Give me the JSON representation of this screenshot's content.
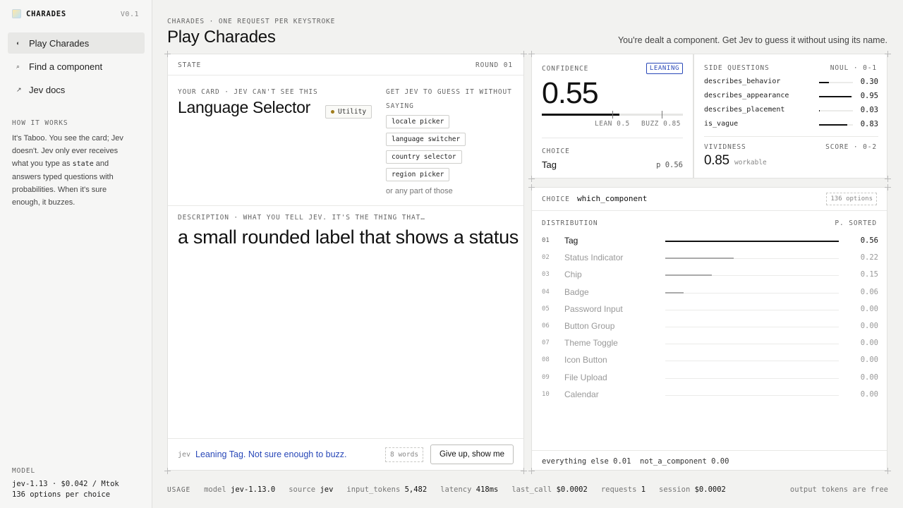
{
  "app": {
    "name": "CHARADES",
    "version": "V0.1"
  },
  "sidebar": {
    "nav": [
      {
        "label": "Play Charades",
        "icon": "◐",
        "icon_name": "half-circle-icon"
      },
      {
        "label": "Find a component",
        "icon": "⌕",
        "icon_name": "search-icon"
      },
      {
        "label": "Jev docs",
        "icon": "↗",
        "icon_name": "external-link-icon"
      }
    ],
    "how_it_works": {
      "title": "HOW IT WORKS",
      "text_1": "It's Taboo. You see the card; Jev doesn't. Jev only ever receives what you type as ",
      "code": "state",
      "text_2": " and answers typed questions with probabilities. When it's sure enough, it buzzes."
    },
    "model": {
      "title": "MODEL",
      "line_1": "jev-1.13 · $0.042 / Mtok",
      "line_2": "136 options per choice"
    }
  },
  "header": {
    "crumb": "CHARADES · ONE REQUEST PER KEYSTROKE",
    "title": "Play Charades",
    "subtitle": "You're dealt a component. Get Jev to guess it without using its name."
  },
  "state": {
    "label": "STATE",
    "round": "ROUND 01",
    "card_caption": "YOUR CARD · JEV CAN'T SEE THIS",
    "card_name": "Language Selector",
    "card_category": "Utility",
    "guess_caption": "GET JEV TO GUESS IT WITHOUT SAYING",
    "taboo_words": [
      "locale picker",
      "language switcher",
      "country selector",
      "region picker"
    ],
    "taboo_note": "or any part of those",
    "description_caption": "DESCRIPTION · WHAT YOU TELL JEV. IT'S THE THING THAT…",
    "description": "a small rounded label that shows a status",
    "footer": {
      "speaker": "jev",
      "message": "Leaning Tag. Not sure enough to buzz.",
      "word_count": "8 words",
      "give_up_label": "Give up, show me"
    }
  },
  "confidence": {
    "label": "CONFIDENCE",
    "badge": "LEANING",
    "value_text": "0.55",
    "value": 0.55,
    "lean_label": "LEAN 0.5",
    "lean_threshold": 0.5,
    "buzz_label": "BUZZ 0.85",
    "buzz_threshold": 0.85,
    "choice_label": "CHOICE",
    "choice_value": "Tag",
    "choice_p": "p 0.56"
  },
  "side_questions": {
    "label": "SIDE QUESTIONS",
    "meta": "NOUL · 0-1",
    "items": [
      {
        "name": "describes_behavior",
        "value": 0.3,
        "value_text": "0.30"
      },
      {
        "name": "describes_appearance",
        "value": 0.95,
        "value_text": "0.95"
      },
      {
        "name": "describes_placement",
        "value": 0.03,
        "value_text": "0.03"
      },
      {
        "name": "is_vague",
        "value": 0.83,
        "value_text": "0.83"
      }
    ],
    "vividness_label": "VIVIDNESS",
    "vividness_meta": "SCORE · 0-2",
    "vividness_value": "0.85",
    "vividness_note": "workable"
  },
  "distribution": {
    "choice_label": "CHOICE",
    "choice_name": "which_component",
    "options_badge": "136 options",
    "label": "DISTRIBUTION",
    "meta": "P. SORTED",
    "rows": [
      {
        "idx": "01",
        "label": "Tag",
        "p": 0.56,
        "p_text": "0.56"
      },
      {
        "idx": "02",
        "label": "Status Indicator",
        "p": 0.22,
        "p_text": "0.22"
      },
      {
        "idx": "03",
        "label": "Chip",
        "p": 0.15,
        "p_text": "0.15"
      },
      {
        "idx": "04",
        "label": "Badge",
        "p": 0.06,
        "p_text": "0.06"
      },
      {
        "idx": "05",
        "label": "Password Input",
        "p": 0.0,
        "p_text": "0.00"
      },
      {
        "idx": "06",
        "label": "Button Group",
        "p": 0.0,
        "p_text": "0.00"
      },
      {
        "idx": "07",
        "label": "Theme Toggle",
        "p": 0.0,
        "p_text": "0.00"
      },
      {
        "idx": "08",
        "label": "Icon Button",
        "p": 0.0,
        "p_text": "0.00"
      },
      {
        "idx": "09",
        "label": "File Upload",
        "p": 0.0,
        "p_text": "0.00"
      },
      {
        "idx": "10",
        "label": "Calendar",
        "p": 0.0,
        "p_text": "0.00"
      }
    ],
    "footer_else": "everything else 0.01",
    "footer_not": "not_a_component 0.00"
  },
  "usage": {
    "label": "USAGE",
    "model_k": "model",
    "model_v": "jev-1.13.0",
    "source_k": "source",
    "source_v": "jev",
    "tokens_k": "input_tokens",
    "tokens_v": "5,482",
    "latency_k": "latency",
    "latency_v": "418ms",
    "last_k": "last_call",
    "last_v": "$0.0002",
    "req_k": "requests",
    "req_v": "1",
    "session_k": "session",
    "session_v": "$0.0002",
    "right": "output tokens are free"
  },
  "colors": {
    "accent": "#2948b8",
    "badge_dot": "#a07d1c",
    "ink": "#111111"
  }
}
